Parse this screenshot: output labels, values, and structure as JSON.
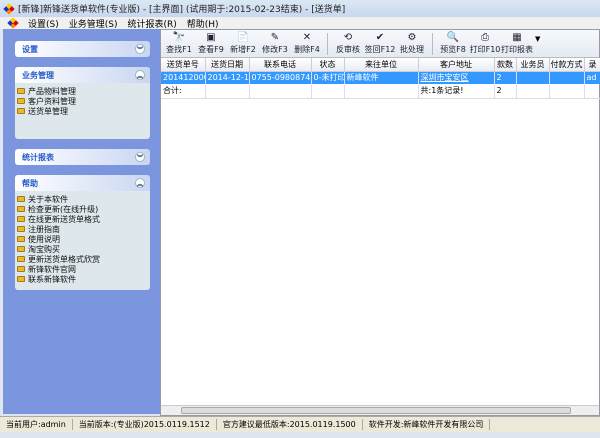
{
  "window": {
    "title": "[新锋]新锋送货单软件(专业版) - [主界面] (试用期于:2015-02-23结束) - [送货单]"
  },
  "menu": [
    "设置(S)",
    "业务管理(S)",
    "统计报表(R)",
    "帮助(H)"
  ],
  "sidebar": [
    {
      "title": "设置",
      "expanded": false,
      "items": []
    },
    {
      "title": "业务管理",
      "expanded": true,
      "items": [
        "产品物料管理",
        "客户资料管理",
        "送货单管理"
      ]
    },
    {
      "title": "统计报表",
      "expanded": false,
      "items": []
    },
    {
      "title": "帮助",
      "expanded": true,
      "items": [
        "关于本软件",
        "检查更新(在线升级)",
        "在线更新送货单格式",
        "注册指南",
        "使用说明",
        "淘宝购买",
        "更新送货单格式欣赏",
        "新锋软件官网",
        "联系新锋软件"
      ]
    }
  ],
  "toolbar": [
    {
      "label": "查找F1",
      "icon": "binoculars-icon",
      "glyph": "🔭"
    },
    {
      "label": "查看F9",
      "icon": "view-icon",
      "glyph": "▣"
    },
    {
      "label": "新增F2",
      "icon": "new-doc-icon",
      "glyph": "📄"
    },
    {
      "label": "修改F3",
      "icon": "edit-icon",
      "glyph": "✎"
    },
    {
      "label": "删除F4",
      "icon": "delete-icon",
      "glyph": "✕"
    },
    {
      "label": "反审核",
      "icon": "unaudit-icon",
      "glyph": "⟲"
    },
    {
      "label": "签回F12",
      "icon": "check-icon",
      "glyph": "✔"
    },
    {
      "label": "批处理",
      "icon": "batch-icon",
      "glyph": "⚙"
    },
    {
      "label": "预览F8",
      "icon": "preview-icon",
      "glyph": "🔍"
    },
    {
      "label": "打印F10",
      "icon": "printer-icon",
      "glyph": "⎙"
    },
    {
      "label": "打印报表",
      "icon": "report-icon",
      "glyph": "▦"
    }
  ],
  "table": {
    "columns": [
      "送货单号",
      "送货日期",
      "联系电话",
      "状态",
      "来往单位",
      "客户地址",
      "款数",
      "业务员",
      "付款方式",
      "录"
    ],
    "rows": [
      [
        "2014120001",
        "2014-12-15",
        "0755-09808745",
        "0-未打印",
        "新峰软件",
        "深圳市宝安区",
        "2",
        "",
        "",
        "ad"
      ]
    ],
    "summary": [
      "合计:",
      "",
      "",
      "",
      "",
      "共:1条记录!",
      "2",
      "",
      "",
      ""
    ]
  },
  "status": [
    "当前用户:admin",
    "当前版本:(专业版)2015.0119.1512",
    "官方建议最低版本:2015.0119.1500",
    "软件开发:新峰软件开发有限公司"
  ]
}
